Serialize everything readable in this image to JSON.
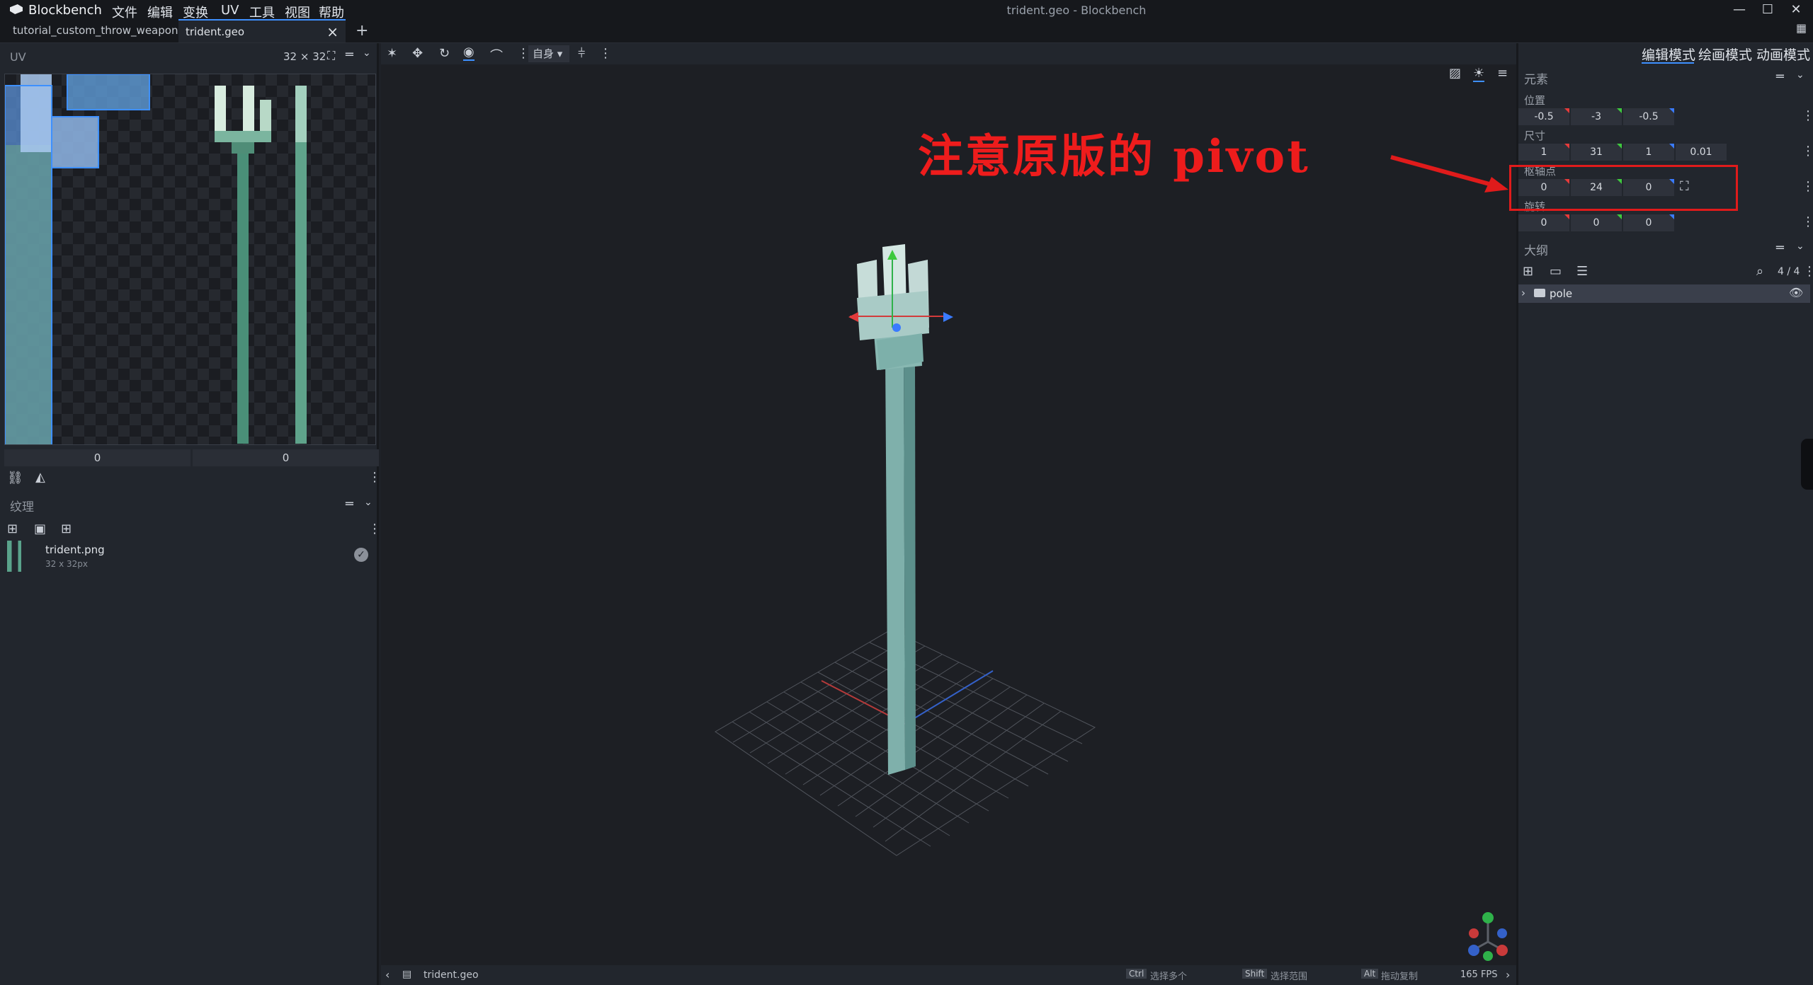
{
  "titlebar": {
    "app_name": "Blockbench",
    "menu": [
      "文件",
      "编辑",
      "变换",
      "UV",
      "工具",
      "视图",
      "帮助"
    ],
    "window_title": "trident.geo - Blockbench"
  },
  "tabs": [
    {
      "label": "tutorial_custom_throw_weapon.g"
    },
    {
      "label": "trident.geo",
      "close": "×"
    }
  ],
  "add_tab": "+",
  "uv_panel": {
    "title": "UV",
    "size_label": "32 × 32",
    "field_u": "0",
    "field_v": "0"
  },
  "texture_panel": {
    "title": "纹理",
    "texture_name": "trident.png",
    "texture_size": "32 x 32px"
  },
  "viewport_toolbar": {
    "space_dropdown": "自身"
  },
  "mode_tabs": [
    "编辑模式",
    "绘画模式",
    "动画模式"
  ],
  "element_panel": {
    "title": "元素",
    "position_label": "位置",
    "position": [
      "-0.5",
      "-3",
      "-0.5"
    ],
    "size_label": "尺寸",
    "size": [
      "1",
      "31",
      "1",
      "0.01"
    ],
    "pivot_label": "枢轴点",
    "pivot": [
      "0",
      "24",
      "0"
    ],
    "rotation_label": "旋转",
    "rotation": [
      "0",
      "0",
      "0"
    ]
  },
  "outliner": {
    "title": "大纲",
    "count": "4 / 4",
    "group_name": "pole"
  },
  "statusbar": {
    "file": "trident.geo",
    "ctrl_key": "Ctrl",
    "ctrl_hint": "选择多个",
    "shift_key": "Shift",
    "shift_hint": "选择范围",
    "alt_key": "Alt",
    "alt_hint": "拖动复制",
    "fps": "165 FPS"
  },
  "annotation": {
    "text": "注意原版的 pivot"
  },
  "colors": {
    "accent": "#3e90ff",
    "annotation_red": "#e01b1b",
    "axis_x": "#e63b3b",
    "axis_y": "#3ec93e",
    "axis_z": "#3a7bff"
  }
}
